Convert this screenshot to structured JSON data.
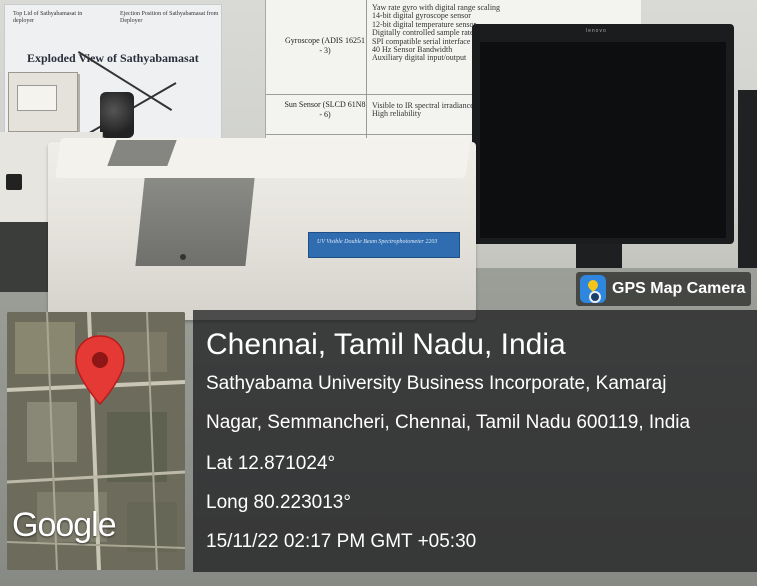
{
  "badge": {
    "label": "GPS Map Camera",
    "icon": "gps-map-camera-app-icon"
  },
  "location": {
    "title": "Chennai, Tamil Nadu, India",
    "address_line1": "Sathyabama University Business Incorporate, Kamaraj",
    "address_line2": "Nagar, Semmancheri, Chennai, Tamil Nadu 600119, India",
    "latitude": "Lat 12.871024°",
    "longitude": "Long 80.223013°",
    "timestamp": "15/11/22 02:17 PM GMT +05:30"
  },
  "map": {
    "provider": "Google",
    "marker_color": "#e53935"
  },
  "poster_left": {
    "caption_1": "Top Lid of Sathyabamasat in deployer",
    "caption_2": "Ejection Position of Sathyabamasat from Deployer",
    "title": "Exploded View of Sathyabamasat"
  },
  "poster_table": {
    "rows": [
      {
        "label": "Gyroscope (ADIS 16251 - 3)",
        "text": "Yaw rate gyro with digital range scaling\n14-bit digital gyroscope sensor\n12-bit digital temperature sensor\nDigitally controlled sample rate\nSPI compatible serial interface\n40 Hz Sensor Bandwidth\nAuxiliary digital input/output"
      },
      {
        "label": "Sun Sensor (SLCD 61N8 - 6)",
        "text": "Visible to IR spectral irradiance\nHigh reliability"
      }
    ]
  },
  "monitor": {
    "brand": "lenovo"
  },
  "instrument_label": "UV Visible Double Beam Spectrophotometer 2203"
}
